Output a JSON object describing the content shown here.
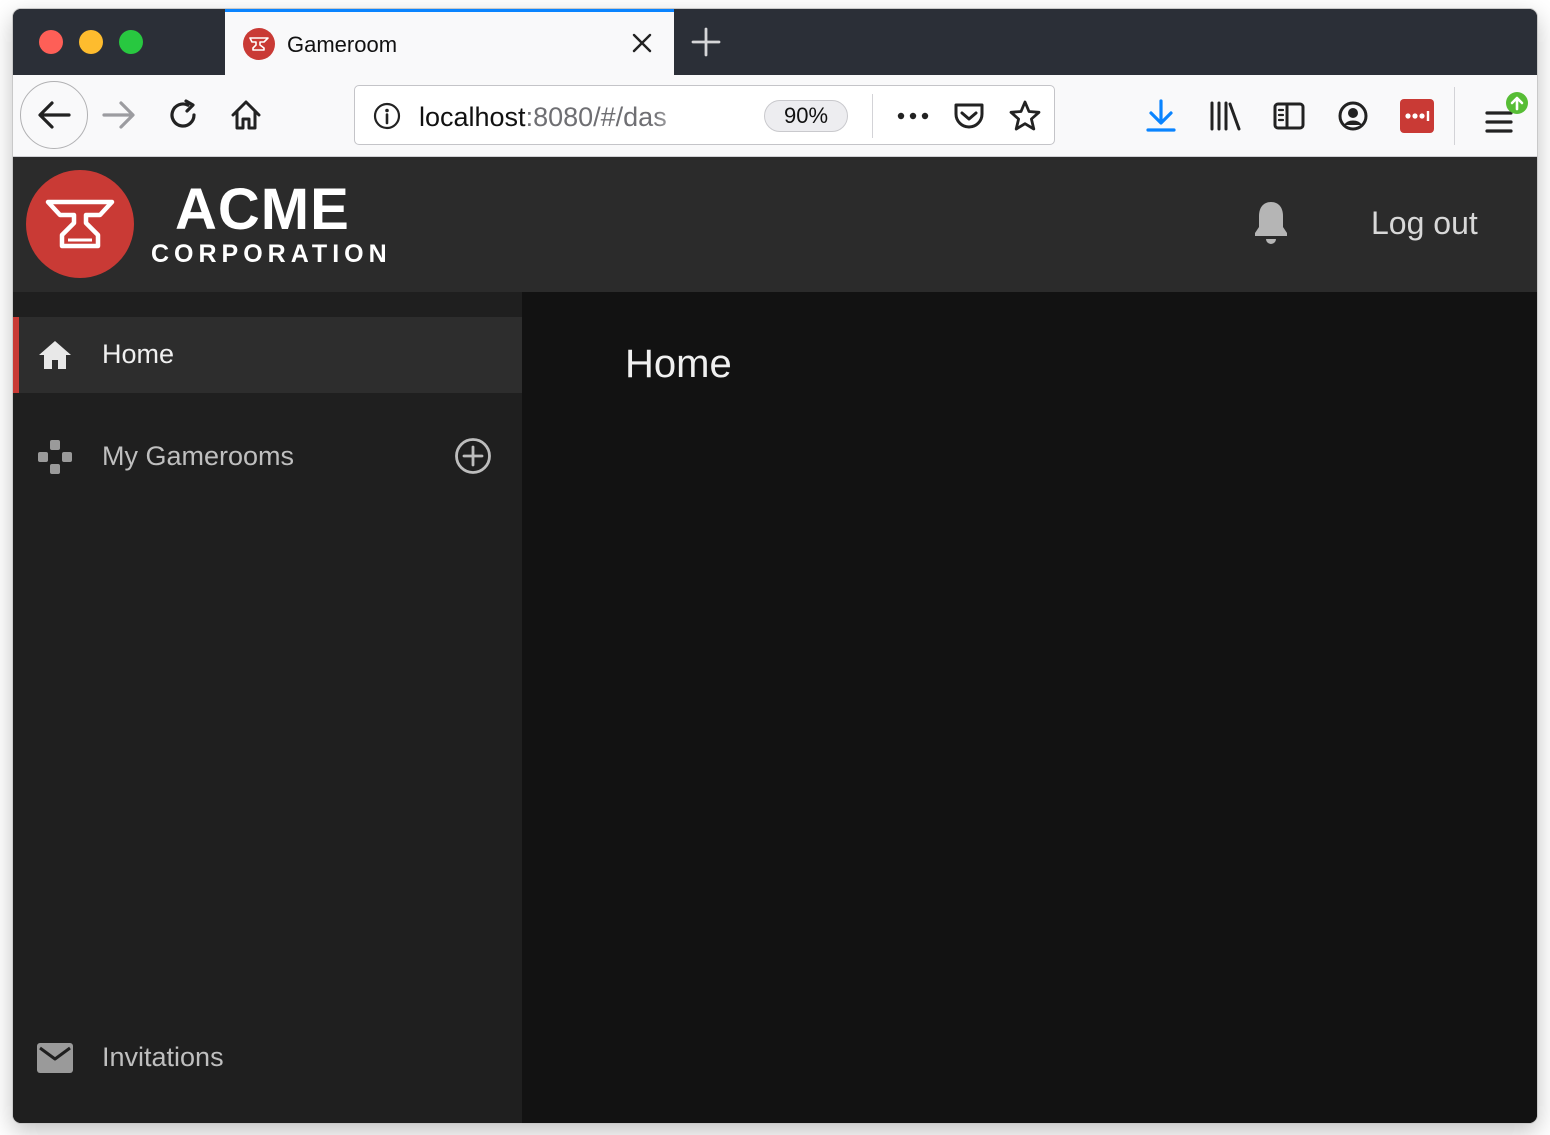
{
  "browser": {
    "tab": {
      "title": "Gameroom"
    },
    "url": {
      "host": "localhost",
      "rest": ":8080/#/das"
    },
    "zoom": "90%"
  },
  "header": {
    "logo": {
      "word": "ACME",
      "sub": "CORPORATION"
    },
    "logout_label": "Log out"
  },
  "sidebar": {
    "items": [
      {
        "label": "Home",
        "icon": "home-icon",
        "active": true
      },
      {
        "label": "My Gamerooms",
        "icon": "gamepad-icon"
      },
      {
        "label": "Invitations",
        "icon": "mail-icon"
      }
    ]
  },
  "main": {
    "title": "Home"
  },
  "colors": {
    "brand_red": "#c93a35",
    "header_bg": "#2b2b2b",
    "sidebar_bg": "#1f1f1f",
    "main_bg": "#121212",
    "accent_blue": "#0a84ff"
  }
}
